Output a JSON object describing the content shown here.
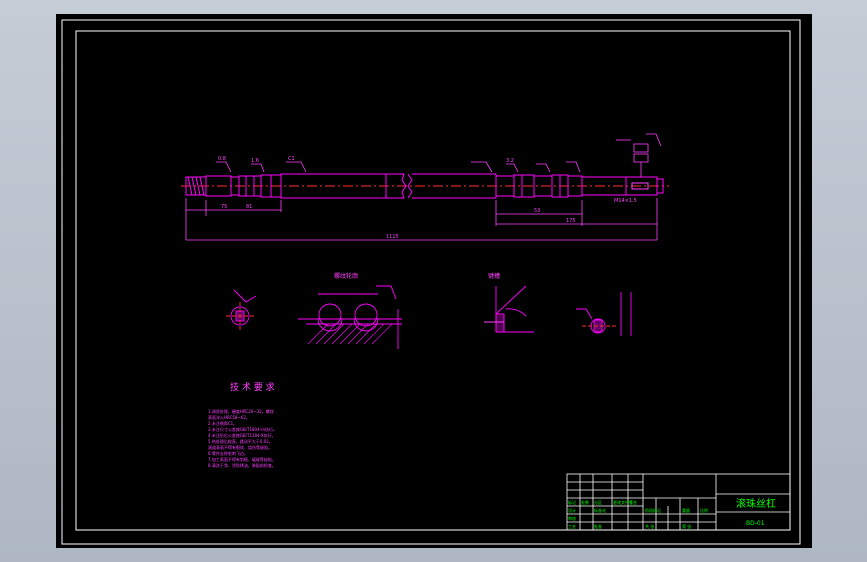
{
  "drawing": {
    "title_block": {
      "part_name": "滚珠丝杠",
      "drawing_no": "BD-01",
      "row_labels_left": [
        "标记",
        "处数",
        "分区",
        "更改文件号",
        "签名",
        "年月日"
      ],
      "row_labels_design": [
        "设计",
        "标准化"
      ],
      "row_labels_mid": [
        "阶段标记",
        "重量",
        "比例"
      ],
      "row_labels_bottom": [
        "审核",
        "工艺",
        "批准",
        "共 张",
        "第 张"
      ]
    },
    "tech_requirements": {
      "heading": "技 术 要 求",
      "lines": [
        "1.调质处理，硬度HRC26~32。螺纹",
        "  表面淬火HRC58~62。",
        "2.未注倒角C1。",
        "3.未注尺寸公差按GB/T1804-m执行。",
        "4.未注形位公差按GB/T1184-K执行。",
        "5.热处理后校直，跳动不大于0.02。",
        "  滚道表面不得有裂纹、烧伤等缺陷。",
        "6.零件去除毛刺飞边。",
        "7.加工表面不得有划痕、磕碰等缺陷。",
        "8.清洗干净，涂防锈油，装配前检查。"
      ]
    },
    "section_labels": {
      "thread_detail": "螺纹轮廓",
      "keyway_detail": "键槽"
    },
    "dimensions": {
      "overall_length": "1115",
      "left_len_1": "75",
      "left_len_2": "81",
      "right_len_1": "53",
      "right_len_2": "175",
      "right_thread": "M14×1.5",
      "chamfer": "C1",
      "roughness_1": "0.8",
      "roughness_2": "1.6",
      "roughness_3": "3.2"
    },
    "colors": {
      "background": "#000000",
      "frame": "#ffffff",
      "geometry": "#ff00ff",
      "centerline": "#ff3030",
      "dimension": "#ff40ff",
      "title_text": "#00ff00",
      "hatch": "#ff00ff"
    }
  }
}
